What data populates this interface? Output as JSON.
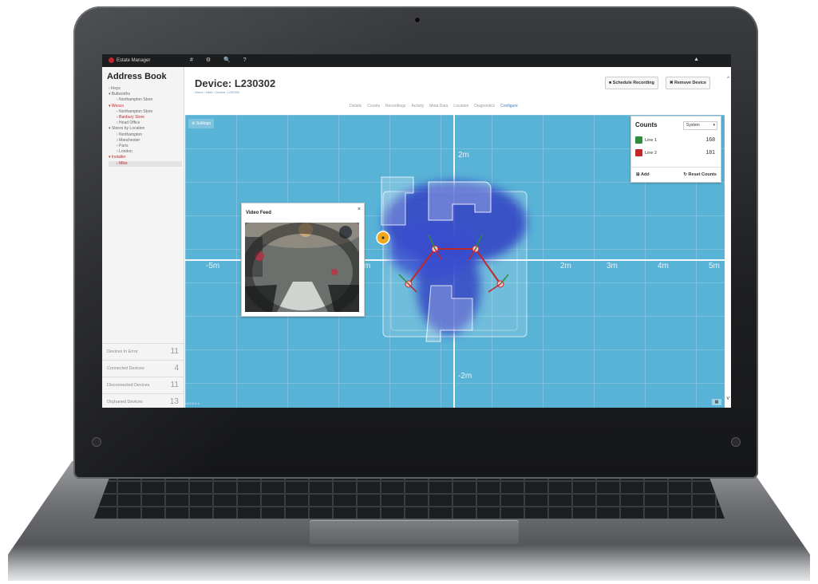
{
  "topbar": {
    "brand": "Estate Manager",
    "icons": "# ⚙ 🔍 ?",
    "user_icon": "person-icon"
  },
  "sidebar": {
    "title": "Address Book",
    "tree": [
      {
        "label": "› Irisys",
        "level": 0,
        "style": "normal"
      },
      {
        "label": "▾ Bullworths",
        "level": 0,
        "style": "normal"
      },
      {
        "label": "› Northampton Store",
        "level": 1,
        "style": "normal"
      },
      {
        "label": "▾ Wesco",
        "level": 0,
        "style": "red"
      },
      {
        "label": "› Northampton Store",
        "level": 1,
        "style": "normal"
      },
      {
        "label": "› Banbury Store",
        "level": 1,
        "style": "red"
      },
      {
        "label": "› Head Office",
        "level": 1,
        "style": "normal"
      },
      {
        "label": "▾ Stores by Location",
        "level": 0,
        "style": "normal"
      },
      {
        "label": "› Northampton",
        "level": 1,
        "style": "normal"
      },
      {
        "label": "› Manchester",
        "level": 1,
        "style": "normal"
      },
      {
        "label": "› Paris",
        "level": 1,
        "style": "normal"
      },
      {
        "label": "› London",
        "level": 1,
        "style": "normal"
      },
      {
        "label": "▾ Installer",
        "level": 0,
        "style": "red"
      },
      {
        "label": "› Mike",
        "level": 1,
        "style": "sel"
      }
    ],
    "counters": [
      {
        "label": "Devices In Error",
        "value": "11"
      },
      {
        "label": "Connected Devices",
        "value": "4"
      },
      {
        "label": "Disconnected Devices",
        "value": "11"
      },
      {
        "label": "Orphaned Devices",
        "value": "13"
      }
    ]
  },
  "header": {
    "title": "Device: L230302",
    "breadcrumb": "Home › Mike › Device: L230302",
    "schedule_label": "■ Schedule Recording",
    "remove_label": "✖ Remove Device"
  },
  "tabs": [
    "Details",
    "Counts",
    "Recordings",
    "Activity",
    "Meta Data",
    "Location",
    "Diagnostics",
    "Configure"
  ],
  "active_tab": "Configure",
  "map": {
    "settings_label": "⚙ Settings",
    "version": "v4.2.0.0.4",
    "ticks_x": [
      "-5m",
      "m",
      "2m",
      "3m",
      "4m",
      "5m"
    ],
    "ticks_y": [
      "2m",
      "-2m"
    ]
  },
  "video_feed": {
    "title": "Video Feed",
    "close": "×"
  },
  "counts": {
    "title": "Counts",
    "select_value": "System",
    "lines": [
      {
        "label": "Line 1",
        "value": "168",
        "color": "#2e8b3e"
      },
      {
        "label": "Line 2",
        "value": "181",
        "color": "#c0272d"
      }
    ],
    "add_label": "Add",
    "reset_label": "Reset Counts"
  },
  "colors": {
    "map_bg": "#59b3d6",
    "heat": "#2f3fc2",
    "accent_red": "#c0272d",
    "line_green": "#2e8b3e"
  }
}
